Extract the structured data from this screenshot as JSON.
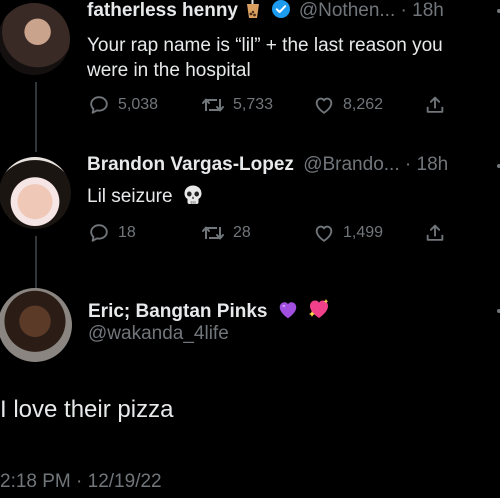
{
  "colors": {
    "background": "#000000",
    "text": "#e7e9ea",
    "muted": "#71767b",
    "verified": "#1d9bf0",
    "thread_line": "#333639"
  },
  "tweet1": {
    "name": "fatherless henny",
    "name_emoji": "bubble-tea-emoji",
    "handle": "@Nothen...",
    "time": "· 18h",
    "text_line1": "Your rap name is “lil” + the last reason you",
    "text_line2": "were in the hospital",
    "replies": "5,038",
    "retweets": "5,733",
    "likes": "8,262"
  },
  "tweet2": {
    "name": "Brandon Vargas-Lopez",
    "handle": "@Brando...",
    "time": "· 18h",
    "text": "Lil seizure",
    "text_emoji": "skull-emoji",
    "replies": "18",
    "retweets": "28",
    "likes": "1,499"
  },
  "tweet3": {
    "name": "Eric; Bangtan Pinks",
    "name_emojis": [
      "purple-heart-emoji",
      "sparkling-heart-emoji"
    ],
    "handle": "@wakanda_4life",
    "text": "I love their pizza",
    "timestamp": "2:18 PM · 12/19/22"
  }
}
